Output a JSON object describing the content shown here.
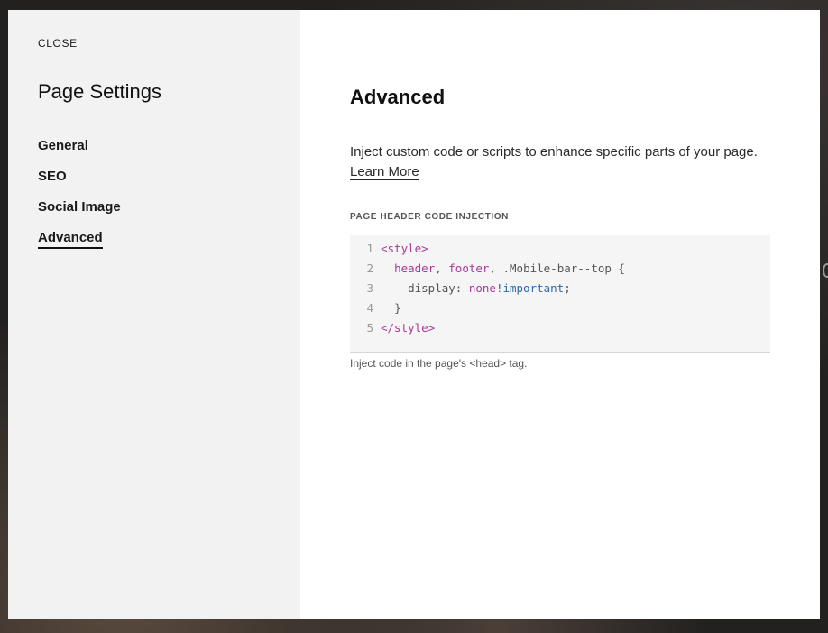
{
  "sidebar": {
    "close_label": "CLOSE",
    "title": "Page Settings",
    "items": [
      {
        "label": "General"
      },
      {
        "label": "SEO"
      },
      {
        "label": "Social Image"
      },
      {
        "label": "Advanced"
      }
    ]
  },
  "main": {
    "title": "Advanced",
    "description": "Inject custom code or scripts to enhance specific parts of your page.",
    "learn_more": "Learn More",
    "section_label": "PAGE HEADER CODE INJECTION",
    "code": {
      "line_numbers": [
        "1",
        "2",
        "3",
        "4",
        "5"
      ],
      "line1": "<style>",
      "line2_a": "header",
      "line2_b": ", ",
      "line2_c": "footer",
      "line2_d": ", .Mobile-bar--top {",
      "line3_a": "display: ",
      "line3_b": "none",
      "line3_c": "!important",
      "line3_d": ";",
      "line4": "}",
      "line5": "</style>"
    },
    "hint": "Inject code in the page's <head> tag."
  },
  "colors": {
    "sidebar_bg": "#f2f2f2",
    "code_bg": "#f5f5f5",
    "syntax_tag": "#a8389c",
    "syntax_important": "#2c6aa8"
  }
}
